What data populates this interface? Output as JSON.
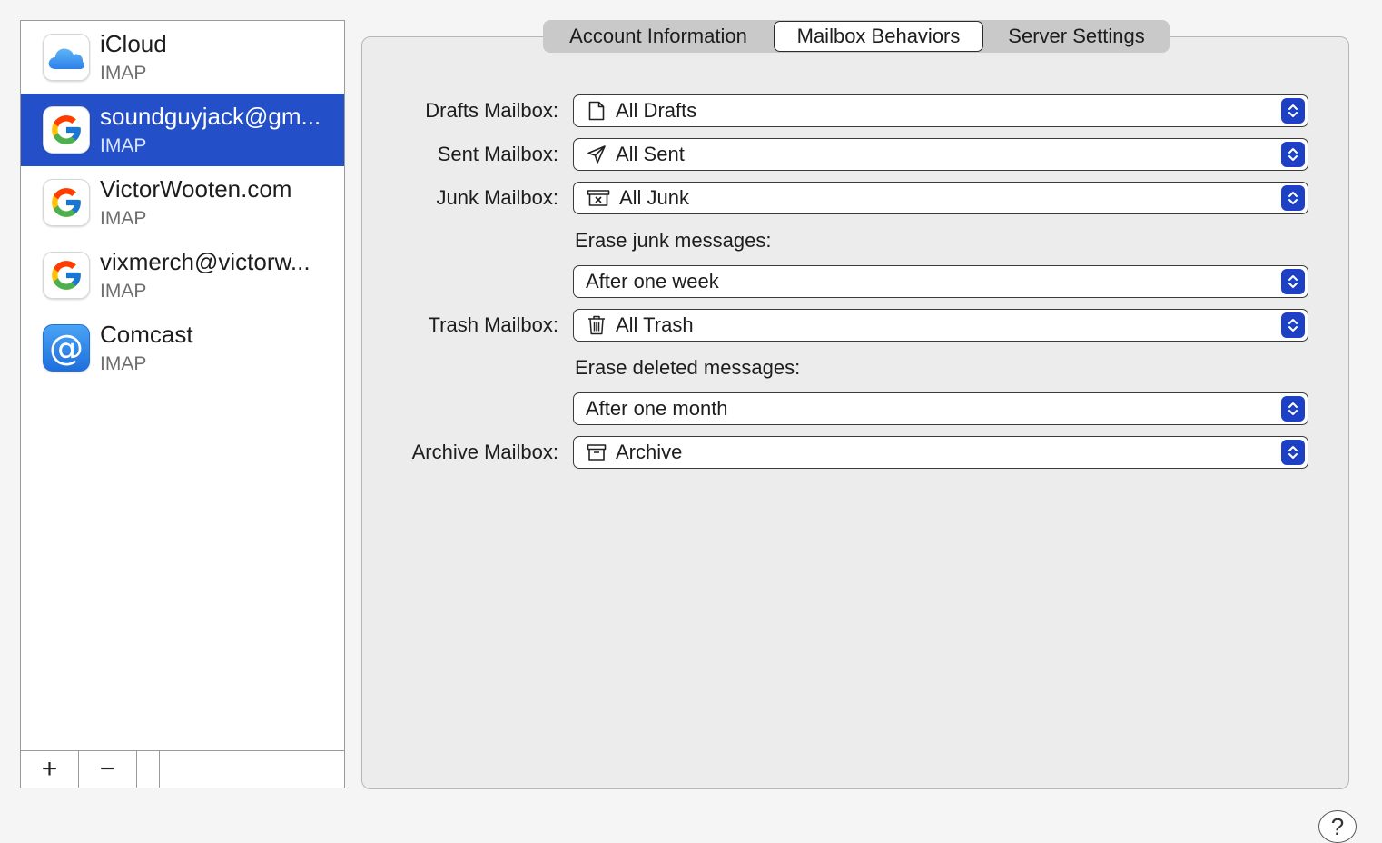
{
  "accounts": [
    {
      "name": "iCloud",
      "type": "IMAP",
      "icon": "icloud-icon",
      "selected": false
    },
    {
      "name": "soundguyjack@gm...",
      "type": "IMAP",
      "icon": "google-icon",
      "selected": true
    },
    {
      "name": "VictorWooten.com",
      "type": "IMAP",
      "icon": "google-icon",
      "selected": false
    },
    {
      "name": "vixmerch@victorw...",
      "type": "IMAP",
      "icon": "google-icon",
      "selected": false
    },
    {
      "name": "Comcast",
      "type": "IMAP",
      "icon": "at-sign-icon",
      "selected": false
    }
  ],
  "list_footer": {
    "add_label": "+",
    "remove_label": "−"
  },
  "tabs": [
    {
      "label": "Account Information",
      "selected": false
    },
    {
      "label": "Mailbox Behaviors",
      "selected": true
    },
    {
      "label": "Server Settings",
      "selected": false
    }
  ],
  "settings": {
    "drafts": {
      "label": "Drafts Mailbox:",
      "value": "All Drafts",
      "icon": "document-icon"
    },
    "sent": {
      "label": "Sent Mailbox:",
      "value": "All Sent",
      "icon": "paper-plane-icon"
    },
    "junk": {
      "label": "Junk Mailbox:",
      "value": "All Junk",
      "icon": "junk-box-icon"
    },
    "erase_junk": {
      "label": "Erase junk messages:",
      "value": "After one week"
    },
    "trash": {
      "label": "Trash Mailbox:",
      "value": "All Trash",
      "icon": "trash-icon"
    },
    "erase_deleted": {
      "label": "Erase deleted messages:",
      "value": "After one month"
    },
    "archive": {
      "label": "Archive Mailbox:",
      "value": "Archive",
      "icon": "archive-box-icon"
    }
  },
  "help_label": "?",
  "colors": {
    "selection": "#2350c8",
    "stepper": "#1e40c4"
  }
}
